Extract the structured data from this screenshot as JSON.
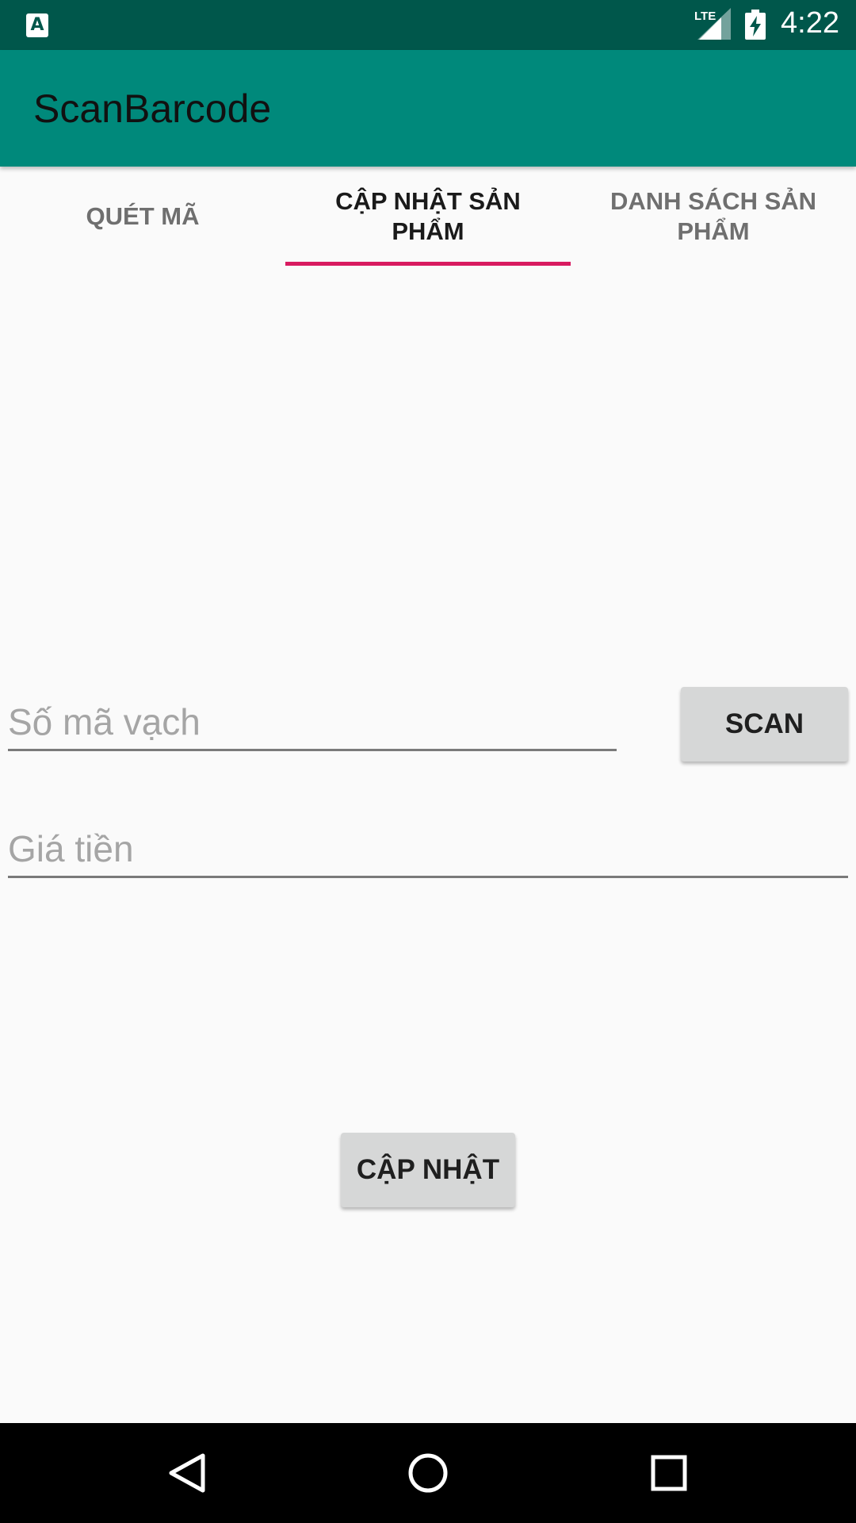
{
  "status_bar": {
    "time": "4:22",
    "network": "LTE",
    "notification_icon": "app-notification-icon",
    "notification_letter": "A",
    "colors": {
      "background": "#00574b"
    }
  },
  "app_bar": {
    "title": "ScanBarcode",
    "colors": {
      "background": "#00897b"
    }
  },
  "tabs": [
    {
      "label": "QUÉT MÃ",
      "selected": false
    },
    {
      "label": "CẬP NHẬT SẢN PHẨM",
      "selected": true
    },
    {
      "label": "DANH SÁCH SẢN PHẨM",
      "selected": false
    }
  ],
  "tab_indicator_color": "#d81b60",
  "form": {
    "barcode": {
      "value": "",
      "placeholder": "Số mã vạch"
    },
    "price": {
      "value": "",
      "placeholder": "Giá tiền"
    },
    "scan_label": "SCAN",
    "update_label": "CẬP NHẬT"
  },
  "nav_bar": {
    "icons": [
      "back-icon",
      "home-icon",
      "recent-apps-icon"
    ]
  }
}
